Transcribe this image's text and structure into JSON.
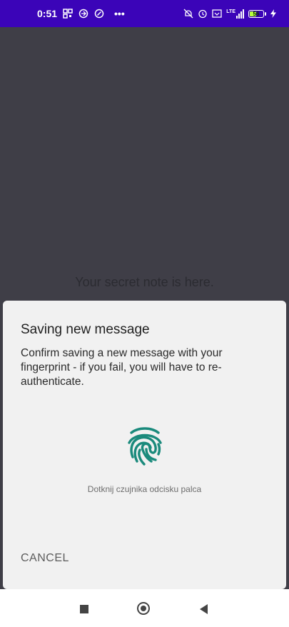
{
  "status_bar": {
    "time": "0:51",
    "more_indicator": "•••",
    "battery_level": "56",
    "battery_fraction": 0.56,
    "network": "LTE",
    "left_icons": [
      "qr-code-icon",
      "app-notification-icon",
      "app-notification-icon"
    ],
    "right_icons": [
      "silent-bell-icon",
      "alarm-icon",
      "vowifi-icon",
      "lte-signal-icon",
      "battery-icon",
      "charging-bolt-icon"
    ]
  },
  "app": {
    "secret_note": "Your secret note is here."
  },
  "dialog": {
    "title": "Saving new message",
    "description": "Confirm saving a new message with your fingerprint - if you fail, you will have to re-authenticate.",
    "fingerprint_icon": "fingerprint-icon",
    "hint": "Dotknij czujnika odcisku palca",
    "cancel_label": "CANCEL"
  },
  "navigation_bar": {
    "buttons": [
      "recents",
      "home",
      "back"
    ]
  },
  "colors": {
    "status_bar": "#3b04b8",
    "scrim": "#3f3e47",
    "sheet": "#f1f1f1",
    "fingerprint_accent": "#1a8a7c"
  }
}
